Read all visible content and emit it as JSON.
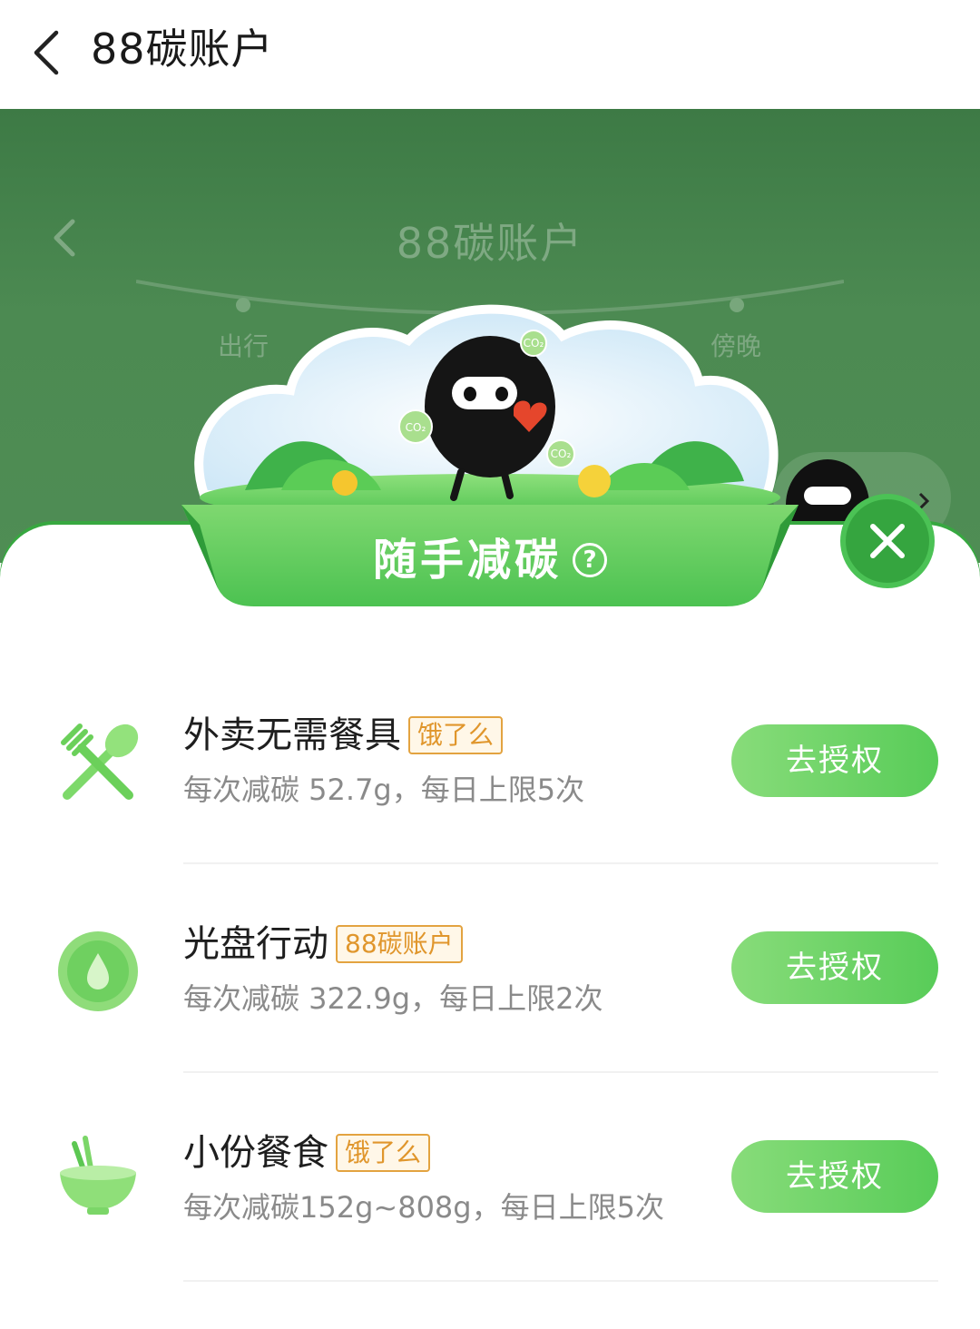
{
  "navbar": {
    "title": "88碳账户"
  },
  "background": {
    "title": "88碳账户",
    "labels": [
      "出行",
      "傍晚"
    ]
  },
  "illustration": {
    "bubble_text": "CO₂"
  },
  "banner": {
    "title": "随手减碳",
    "help_glyph": "?"
  },
  "tasks": [
    {
      "name": "外卖无需餐具",
      "tag": "饿了么",
      "desc": "每次减碳 52.7g，每日上限5次",
      "button": "去授权",
      "icon": "fork-spoon-icon"
    },
    {
      "name": "光盘行动",
      "tag": "88碳账户",
      "desc": "每次减碳 322.9g，每日上限2次",
      "button": "去授权",
      "icon": "water-drop-icon"
    },
    {
      "name": "小份餐食",
      "tag": "饿了么",
      "desc": "每次减碳152g~808g，每日上限5次",
      "button": "去授权",
      "icon": "bowl-chopsticks-icon"
    }
  ],
  "colors": {
    "primary_green": "#4cc655",
    "tag_orange": "#e0962c",
    "bg_green": "#4a8750"
  }
}
